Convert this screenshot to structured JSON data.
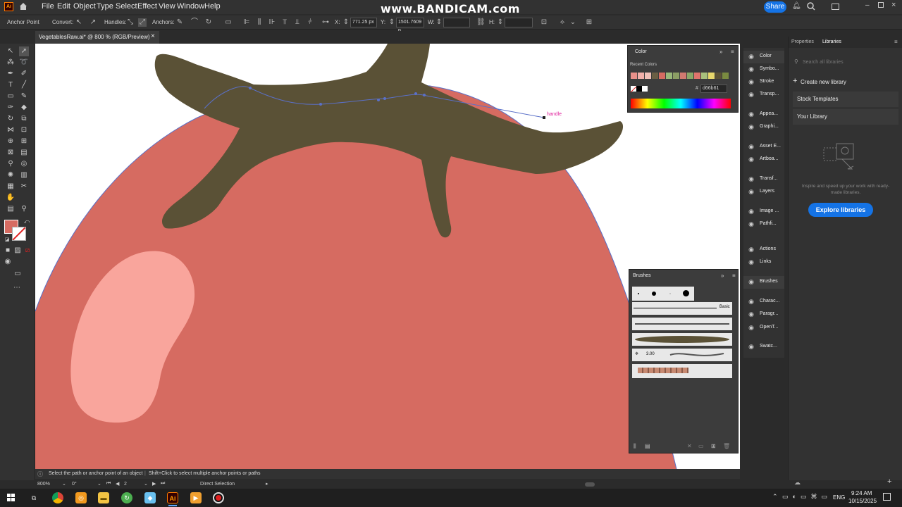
{
  "menubar": {
    "items": [
      "File",
      "Edit",
      "Object",
      "Type",
      "Select",
      "Effect",
      "View",
      "Window",
      "Help"
    ],
    "watermark": "www.BANDICAM.com",
    "share_label": "Share"
  },
  "controlbar": {
    "anchor_point": "Anchor Point",
    "convert": "Convert:",
    "handles": "Handles:",
    "anchors": "Anchors:",
    "x_label": "X:",
    "x_value": "771.25 px",
    "y_label": "Y:",
    "y_value": "1501.7609 p",
    "w_label": "W:",
    "h_label": "H:"
  },
  "document": {
    "tab_title": "VegetablesRaw.ai* @ 800 % (RGB/Preview)",
    "close_symbol": "×"
  },
  "canvas": {
    "handle_label": "handle",
    "colors": {
      "tomato": "#d66b61",
      "highlight": "#f9a59c",
      "stem": "#5a5136",
      "path": "#5a70c8",
      "handle_text": "#e0209c"
    }
  },
  "status": {
    "hint": "Select the path or anchor point of an object",
    "hint2": "Shift+Click to select multiple anchor points or paths",
    "zoom": "800%",
    "rotation": "0°",
    "artboard": "2",
    "tool": "Direct Selection"
  },
  "color_panel": {
    "title": "Color",
    "recent_label": "Recent Colors",
    "hex_label": "#",
    "hex_value": "d66b61",
    "recent_colors": [
      "#e8908a",
      "#f2b0aa",
      "#f0c0b8",
      "#6a5e43",
      "#d66b61",
      "#9ab87a",
      "#8c9e64",
      "#d07a70",
      "#8aa868",
      "#e0746c",
      "#a8c07c",
      "#e8d86c",
      "#5a5136",
      "#7a8a40"
    ]
  },
  "brushes_panel": {
    "title": "Brushes",
    "basic_label": "Basic",
    "size_value": "3.00"
  },
  "panel_icons": [
    {
      "icon": "color-icon",
      "label": "Color"
    },
    {
      "icon": "symbols-icon",
      "label": "Symbo..."
    },
    {
      "icon": "stroke-icon",
      "label": "Stroke"
    },
    {
      "icon": "transparency-icon",
      "label": "Transp..."
    },
    {
      "icon": "appearance-icon",
      "label": "Appea..."
    },
    {
      "icon": "graphic-styles-icon",
      "label": "Graphi..."
    },
    {
      "icon": "asset-export-icon",
      "label": "Asset E..."
    },
    {
      "icon": "artboards-icon",
      "label": "Artboa..."
    },
    {
      "icon": "transform-icon",
      "label": "Transf..."
    },
    {
      "icon": "layers-icon",
      "label": "Layers"
    },
    {
      "icon": "image-trace-icon",
      "label": "Image ..."
    },
    {
      "icon": "pathfinder-icon",
      "label": "Pathfi..."
    },
    {
      "icon": "actions-icon",
      "label": "Actions"
    },
    {
      "icon": "links-icon",
      "label": "Links"
    },
    {
      "icon": "brushes-icon",
      "label": "Brushes"
    },
    {
      "icon": "character-icon",
      "label": "Charac..."
    },
    {
      "icon": "paragraph-icon",
      "label": "Paragr..."
    },
    {
      "icon": "opentype-icon",
      "label": "OpenT..."
    },
    {
      "icon": "swatches-icon",
      "label": "Swatc..."
    }
  ],
  "libraries": {
    "tab_properties": "Properties",
    "tab_libraries": "Libraries",
    "search_placeholder": "Search all libraries",
    "create_label": "Create new library",
    "stock_templates": "Stock Templates",
    "your_library": "Your Library",
    "empty_text": "Inspire and speed up your work with ready-made libraries.",
    "explore_label": "Explore libraries"
  },
  "taskbar": {
    "language": "ENG",
    "time": "9:24 AM",
    "date": "10/15/2025"
  }
}
